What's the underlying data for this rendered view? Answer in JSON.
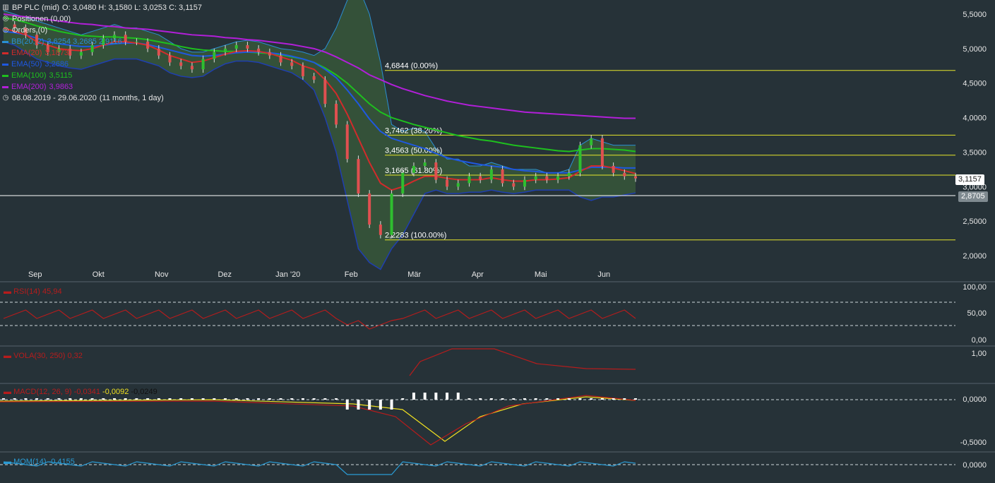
{
  "header": {
    "instrument": "BP PLC (mid)",
    "ohlc": "O: 3,0480   H: 3,1580   L: 3,0253   C: 3,1157",
    "positions": "Positionen (0,00)",
    "orders": "Orders (0)",
    "period": "08.08.2019 - 29.06.2020",
    "period_detail": "(11 months, 1 day)"
  },
  "indicators": [
    {
      "label": "BB(20, 2)",
      "values": "3,6254  3,2685  2,9116",
      "color": "#2a8fd4"
    },
    {
      "label": "EMA(20)",
      "values": "3,1873",
      "color": "#d22b2b"
    },
    {
      "label": "EMA(50)",
      "values": "3,2686",
      "color": "#1f58e0"
    },
    {
      "label": "EMA(100)",
      "values": "3,5115",
      "color": "#1ec01e"
    },
    {
      "label": "EMA(200)",
      "values": "3,9863",
      "color": "#b21fd9"
    }
  ],
  "price_axis": {
    "ticks": [
      "5,5000",
      "5,0000",
      "4,5000",
      "4,0000",
      "3,5000",
      "3,0000",
      "2,5000",
      "2,0000"
    ],
    "last_price": "3,1157",
    "marker_price": "2,8705"
  },
  "fib_levels": [
    {
      "label": "4,6844 (0.00%)",
      "value": 4.6844
    },
    {
      "label": "3,7462 (38.20%)",
      "value": 3.7462
    },
    {
      "label": "3,4563 (50.00%)",
      "value": 3.4563
    },
    {
      "label": "3,1665 (61.80%)",
      "value": 3.1665
    },
    {
      "label": "2,2283 (100.00%)",
      "value": 2.2283
    }
  ],
  "months": [
    "Sep",
    "Okt",
    "Nov",
    "Dez",
    "Jan '20",
    "Feb",
    "Mär",
    "Apr",
    "Mai",
    "Jun"
  ],
  "rsi": {
    "label": "RSI(14)",
    "value": "45,94",
    "ticks": [
      "100,00",
      "50,00",
      "0,00"
    ]
  },
  "vola": {
    "label": "VOLA(30, 250)",
    "value": "0,32",
    "ticks": [
      "1,00"
    ]
  },
  "macd": {
    "label": "MACD(12, 26, 9)",
    "v1": "-0,0341",
    "v2": "-0,0092",
    "v3": "-0,0249",
    "ticks": [
      "0,0000",
      "-0,5000"
    ]
  },
  "mom": {
    "label": "MOM(14)",
    "value": "-0,4155",
    "ticks": [
      "0,0000"
    ]
  },
  "chart_data": {
    "type": "line",
    "title": "BP PLC (mid)",
    "x": [
      0,
      4,
      8,
      12,
      16,
      20,
      24,
      28,
      32,
      36,
      40,
      44,
      48,
      52,
      56,
      60,
      64,
      68,
      72,
      76,
      80,
      84,
      88,
      92,
      96,
      100,
      104,
      108,
      112,
      116,
      120,
      124,
      128,
      132,
      136,
      140,
      144,
      148,
      152,
      156,
      160,
      164,
      168,
      172,
      176,
      180,
      184,
      188,
      192,
      196,
      200,
      204,
      208,
      212,
      216,
      220,
      224,
      228
    ],
    "series": [
      {
        "name": "Close",
        "values": [
          5.35,
          5.3,
          5.2,
          5.05,
          4.95,
          5.0,
          4.9,
          4.95,
          5.05,
          5.15,
          5.2,
          5.1,
          5.1,
          5.0,
          4.9,
          4.8,
          4.75,
          4.7,
          4.85,
          4.95,
          5.0,
          5.05,
          5.0,
          4.95,
          4.9,
          4.8,
          4.75,
          4.6,
          4.55,
          4.2,
          3.9,
          3.4,
          2.9,
          2.45,
          2.3,
          2.9,
          3.2,
          3.3,
          3.35,
          3.1,
          3.0,
          3.05,
          3.15,
          3.1,
          3.25,
          3.05,
          3.0,
          3.1,
          3.15,
          3.1,
          3.15,
          3.2,
          3.6,
          3.7,
          3.3,
          3.2,
          3.15,
          3.12
        ]
      },
      {
        "name": "EMA(20)",
        "values": [
          5.3,
          5.25,
          5.2,
          5.1,
          5.05,
          5.0,
          4.98,
          4.97,
          5.0,
          5.05,
          5.1,
          5.1,
          5.08,
          5.05,
          4.98,
          4.9,
          4.85,
          4.8,
          4.82,
          4.87,
          4.92,
          4.96,
          4.97,
          4.96,
          4.93,
          4.88,
          4.83,
          4.75,
          4.7,
          4.55,
          4.35,
          4.05,
          3.7,
          3.35,
          3.05,
          2.95,
          3.0,
          3.08,
          3.15,
          3.15,
          3.12,
          3.1,
          3.1,
          3.1,
          3.13,
          3.1,
          3.08,
          3.08,
          3.1,
          3.1,
          3.11,
          3.13,
          3.22,
          3.3,
          3.3,
          3.27,
          3.23,
          3.19
        ]
      },
      {
        "name": "EMA(50)",
        "values": [
          5.25,
          5.23,
          5.2,
          5.15,
          5.1,
          5.07,
          5.05,
          5.03,
          5.03,
          5.05,
          5.07,
          5.08,
          5.08,
          5.06,
          5.02,
          4.98,
          4.94,
          4.9,
          4.89,
          4.9,
          4.92,
          4.94,
          4.95,
          4.95,
          4.94,
          4.92,
          4.89,
          4.85,
          4.8,
          4.7,
          4.58,
          4.4,
          4.2,
          3.98,
          3.8,
          3.7,
          3.65,
          3.6,
          3.55,
          3.48,
          3.42,
          3.38,
          3.35,
          3.32,
          3.3,
          3.28,
          3.25,
          3.23,
          3.22,
          3.2,
          3.2,
          3.2,
          3.24,
          3.28,
          3.28,
          3.28,
          3.27,
          3.27
        ]
      },
      {
        "name": "EMA(100)",
        "values": [
          5.45,
          5.42,
          5.38,
          5.33,
          5.29,
          5.25,
          5.22,
          5.19,
          5.18,
          5.17,
          5.17,
          5.16,
          5.15,
          5.13,
          5.1,
          5.07,
          5.03,
          5.0,
          4.98,
          4.97,
          4.96,
          4.96,
          4.95,
          4.94,
          4.93,
          4.91,
          4.88,
          4.85,
          4.8,
          4.72,
          4.62,
          4.5,
          4.35,
          4.2,
          4.08,
          4.0,
          3.95,
          3.9,
          3.86,
          3.82,
          3.78,
          3.74,
          3.71,
          3.68,
          3.66,
          3.63,
          3.6,
          3.58,
          3.56,
          3.54,
          3.52,
          3.51,
          3.53,
          3.55,
          3.55,
          3.54,
          3.53,
          3.51
        ]
      },
      {
        "name": "EMA(200)",
        "values": [
          5.5,
          5.48,
          5.46,
          5.44,
          5.42,
          5.4,
          5.38,
          5.36,
          5.35,
          5.33,
          5.32,
          5.3,
          5.29,
          5.28,
          5.26,
          5.24,
          5.22,
          5.2,
          5.19,
          5.18,
          5.16,
          5.15,
          5.13,
          5.12,
          5.1,
          5.08,
          5.06,
          5.03,
          5.0,
          4.95,
          4.88,
          4.8,
          4.72,
          4.62,
          4.55,
          4.48,
          4.42,
          4.37,
          4.32,
          4.28,
          4.24,
          4.21,
          4.18,
          4.16,
          4.14,
          4.12,
          4.1,
          4.08,
          4.07,
          4.06,
          4.05,
          4.04,
          4.03,
          4.02,
          4.01,
          4.0,
          3.99,
          3.99
        ]
      },
      {
        "name": "BB upper",
        "values": [
          5.55,
          5.5,
          5.45,
          5.4,
          5.35,
          5.3,
          5.25,
          5.2,
          5.25,
          5.3,
          5.35,
          5.3,
          5.3,
          5.25,
          5.2,
          5.1,
          5.0,
          4.95,
          4.95,
          5.0,
          5.05,
          5.1,
          5.12,
          5.1,
          5.05,
          5.0,
          4.98,
          4.95,
          4.9,
          5.0,
          5.3,
          5.7,
          5.9,
          5.5,
          4.8,
          3.9,
          3.8,
          3.85,
          3.8,
          3.55,
          3.4,
          3.4,
          3.3,
          3.3,
          3.35,
          3.3,
          3.25,
          3.25,
          3.25,
          3.2,
          3.2,
          3.25,
          3.6,
          3.7,
          3.65,
          3.6,
          3.6,
          3.6
        ]
      },
      {
        "name": "BB lower",
        "values": [
          5.1,
          5.05,
          4.95,
          4.85,
          4.8,
          4.75,
          4.72,
          4.7,
          4.75,
          4.8,
          4.85,
          4.85,
          4.85,
          4.8,
          4.75,
          4.65,
          4.6,
          4.58,
          4.6,
          4.7,
          4.78,
          4.82,
          4.82,
          4.8,
          4.75,
          4.7,
          4.65,
          4.55,
          4.4,
          4.0,
          3.5,
          2.8,
          2.1,
          1.9,
          1.8,
          2.1,
          2.3,
          2.6,
          2.9,
          2.95,
          2.9,
          2.9,
          2.92,
          2.92,
          2.95,
          2.92,
          2.9,
          2.92,
          2.95,
          2.95,
          2.95,
          2.95,
          2.85,
          2.8,
          2.85,
          2.85,
          2.88,
          2.91
        ]
      }
    ],
    "ylim": [
      1.8,
      5.6
    ],
    "ylabel": "",
    "xlabel": ""
  }
}
